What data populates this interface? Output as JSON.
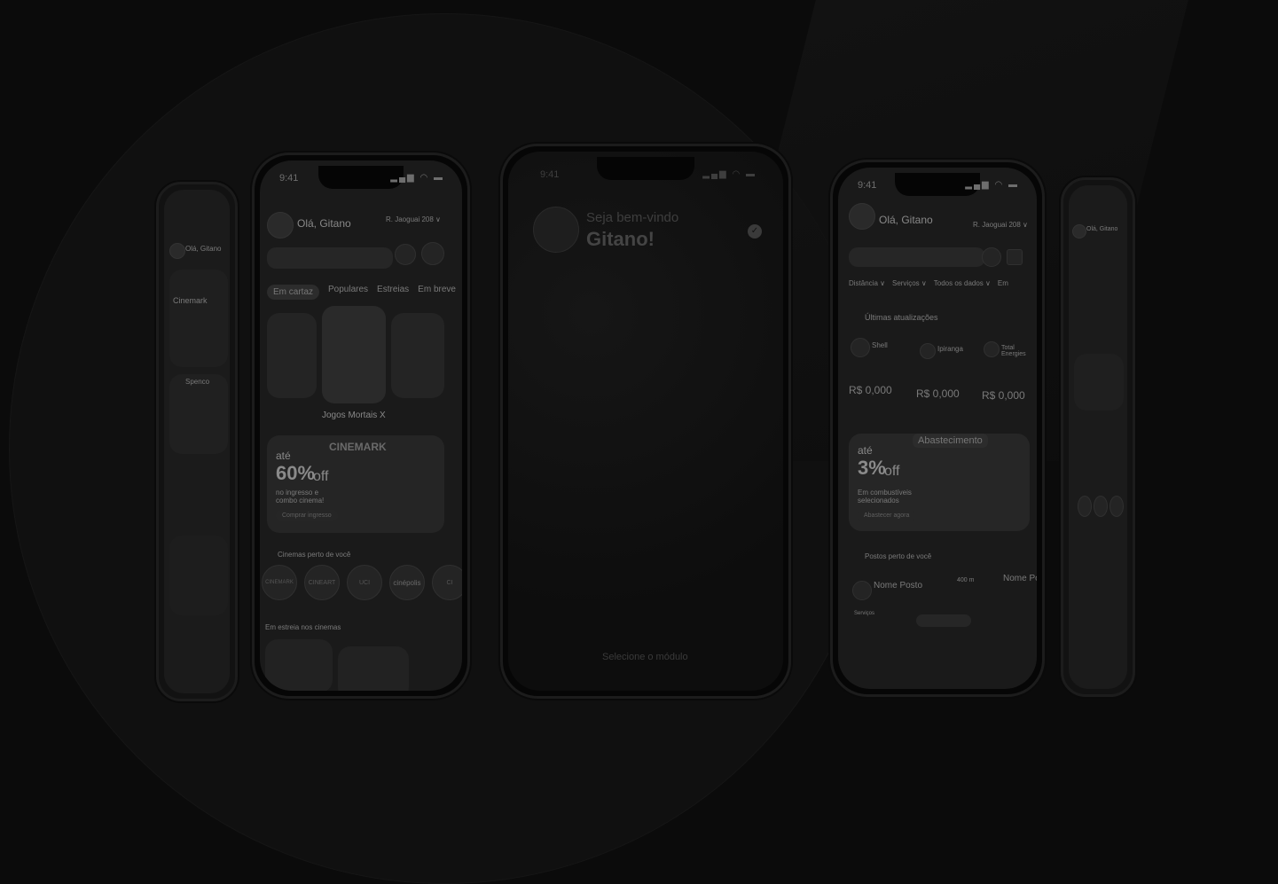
{
  "status": {
    "time": "9:41"
  },
  "left_phone": {
    "greeting": "Olá, Gitano",
    "location": "R. Jaoguai 208 ∨",
    "tabs": [
      "Em cartaz",
      "Populares",
      "Estreias",
      "Em breve"
    ],
    "featured_title": "Jogos Mortais X",
    "promo_brand": "CINEMARK",
    "promo_prefix": "até",
    "promo_value": "60%",
    "promo_suffix": "off",
    "promo_detail": "no ingresso e combo cinema!",
    "promo_cta": "Comprar ingresso",
    "nearby_title": "Cinemas perto de você",
    "cinemas": [
      "CINEMARK",
      "CINEART",
      "UCI",
      "cinépolis",
      "CI"
    ],
    "section_title": "Em estreia nos cinemas"
  },
  "center_phone": {
    "welcome_line1": "Seja bem-vindo",
    "welcome_line2": "Gitano!",
    "select_module": "Selecione o módulo"
  },
  "right_phone": {
    "greeting": "Olá, Gitano",
    "location": "R. Jaoguai 208 ∨",
    "filters": [
      "Distância ∨",
      "Serviços ∨",
      "Todos os dados ∨",
      "Em"
    ],
    "updates_title": "Últimas atualizações",
    "stations": [
      {
        "name": "Shell",
        "price": "R$ 0,000"
      },
      {
        "name": "Ipiranga",
        "price": "R$ 0,000"
      },
      {
        "name": "Total Energies",
        "price": "R$ 0,000"
      }
    ],
    "promo_label": "Abastecimento",
    "promo_prefix": "até",
    "promo_value": "3%",
    "promo_suffix": "off",
    "promo_detail": "Em combustíveis selecionados",
    "promo_cta": "Abastecer agora",
    "nearby_title": "Postos perto de você",
    "post_name": "Nome Posto",
    "post_distance": "400 m",
    "post_name_2": "Nome Po",
    "services_label": "Serviços"
  },
  "far_left_phone": {
    "greeting": "Olá, Gitano",
    "item_a": "Cinemark",
    "item_b": "Spenco"
  },
  "far_right_phone": {
    "greeting": "Olá, Gitano"
  }
}
